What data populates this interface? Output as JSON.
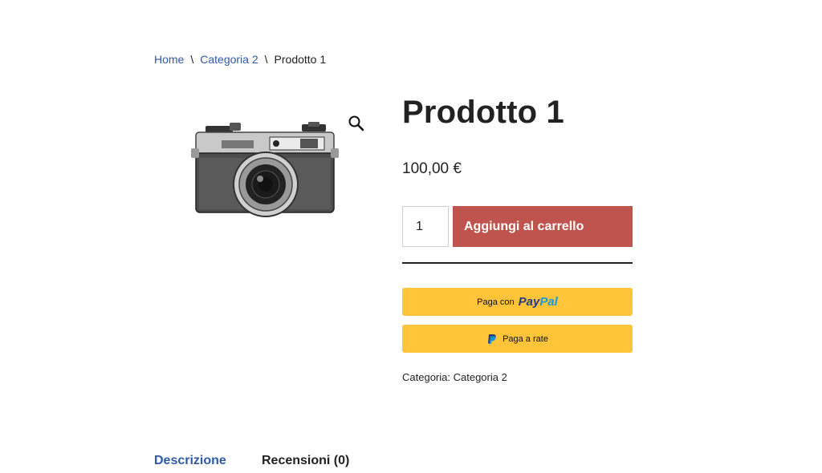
{
  "breadcrumb": {
    "items": [
      "Home",
      "Categoria 2",
      "Prodotto 1"
    ],
    "separator": "\\"
  },
  "product": {
    "title": "Prodotto 1",
    "price": "100,00 €",
    "quantity": "1",
    "add_to_cart_label": "Aggiungi al carrello",
    "image_icon": "camera-image",
    "zoom_icon": "magnifier-icon"
  },
  "payments": {
    "paypal_prefix": "Paga con",
    "paypal_logo_part1": "Pay",
    "paypal_logo_part2": "Pal",
    "pay_later_label": "Paga a rate"
  },
  "meta": {
    "category_label": "Categoria:",
    "category_value": "Categoria 2"
  },
  "tabs": [
    {
      "label": "Descrizione"
    },
    {
      "label": "Recensioni (0)"
    }
  ],
  "colors": {
    "link": "#2f5aa7",
    "add_to_cart": "#be544d",
    "paypal_yellow": "#ffc439",
    "paypal_dark_blue": "#253b80",
    "paypal_light_blue": "#179bd7"
  }
}
